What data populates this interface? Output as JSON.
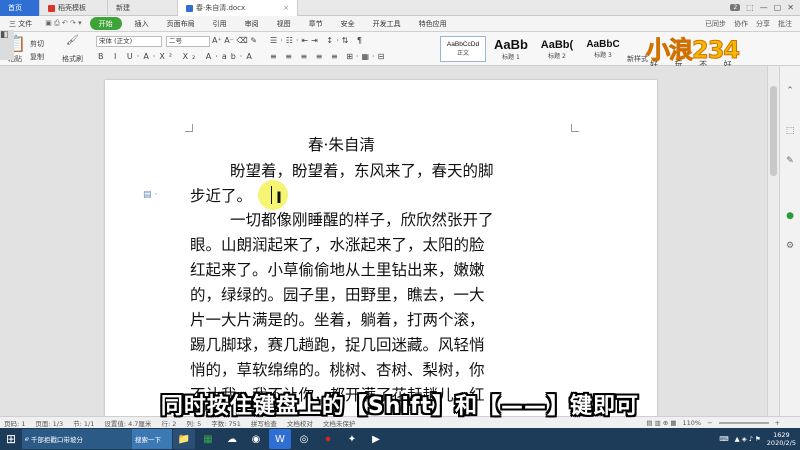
{
  "tabs": [
    {
      "label": "首页"
    },
    {
      "label": "稻壳模板"
    },
    {
      "label": "新建"
    },
    {
      "label": "春·朱自清.docx"
    }
  ],
  "tabbar_right": {
    "badge": "2"
  },
  "menu": {
    "file": "三 文件",
    "items": [
      "开始",
      "插入",
      "页面布局",
      "引用",
      "审阅",
      "视图",
      "章节",
      "安全",
      "开发工具",
      "特色应用"
    ],
    "right": [
      "已同步",
      "协作",
      "分享",
      "批注"
    ]
  },
  "ribbon": {
    "paste": "粘贴",
    "cut": "剪切",
    "copy": "复制",
    "format_painter": "格式刷",
    "font_name": "宋体 (正文)",
    "font_size": "二号",
    "styles": [
      {
        "sample": "AaBbCcDd",
        "name": "正文"
      },
      {
        "sample": "AaBb",
        "name": "标题 1"
      },
      {
        "sample": "AaBb(",
        "name": "标题 2"
      },
      {
        "sample": "AaBbC",
        "name": "标题 3"
      }
    ],
    "new_style": "新样式",
    "logo": "小浪234",
    "logo_sub": "好 玩 不 好"
  },
  "document": {
    "title": "春·朱自清",
    "lines": [
      "盼望着，盼望着，东风来了，春天的脚",
      "步近了。",
      "一切都像刚睡醒的样子，欣欣然张开了",
      "眼。山朗润起来了，水涨起来了，太阳的脸",
      "红起来了。小草偷偷地从土里钻出来，嫩嫩",
      "的，绿绿的。园子里，田野里，瞧去，一大",
      "片一大片满是的。坐着，躺着，打两个滚，",
      "踢几脚球，赛几趟跑，捉几回迷藏。风轻悄",
      "悄的，草软绵绵的。桃树、杏树、梨树，你",
      "不让我，我不让你，都开满了花赶趟儿。红"
    ]
  },
  "status": {
    "page": "页码: 1",
    "pages": "页面: 1/3",
    "section": "节: 1/1",
    "position": "设置值: 4.7厘米",
    "row": "行: 2",
    "col": "列: 5",
    "words": "字数: 751",
    "spell": "拼写检查",
    "align": "文档校对",
    "protect": "文档未保护",
    "zoom": "110%"
  },
  "taskbar": {
    "items": [
      "千部拒戳口带坡分",
      "搜索一下"
    ],
    "clock_time": "1629",
    "clock_date": "2020/2/5"
  },
  "subtitle": "同时按住键盘上的【Shift】和【——】键即可"
}
